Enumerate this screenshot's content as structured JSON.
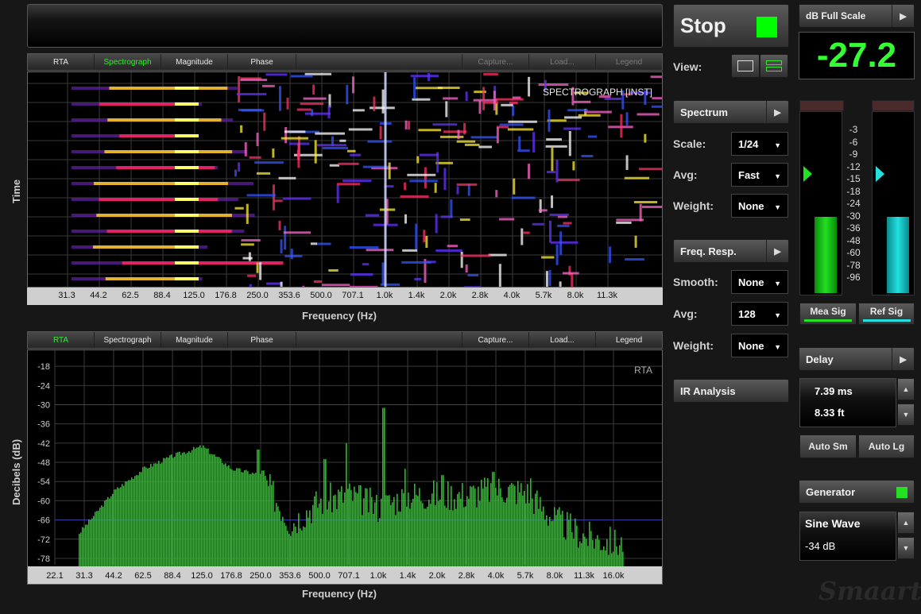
{
  "spectro_tabs": {
    "rta": "RTA",
    "spectrograph": "Spectrograph",
    "magnitude": "Magnitude",
    "phase": "Phase",
    "capture": "Capture...",
    "load": "Load...",
    "legend": "Legend"
  },
  "rta_tabs": {
    "rta": "RTA",
    "spectrograph": "Spectrograph",
    "magnitude": "Magnitude",
    "phase": "Phase",
    "capture": "Capture...",
    "load": "Load...",
    "legend": "Legend"
  },
  "spectrograph": {
    "overlay": "SPECTROGRAPH [INST]",
    "ylabel": "Time",
    "xlabel": "Frequency (Hz)",
    "ticks": [
      "31.3",
      "44.2",
      "62.5",
      "88.4",
      "125.0",
      "176.8",
      "250.0",
      "353.6",
      "500.0",
      "707.1",
      "1.0k",
      "1.4k",
      "2.0k",
      "2.8k",
      "4.0k",
      "5.7k",
      "8.0k",
      "11.3k"
    ]
  },
  "chart_data": {
    "type": "bar",
    "title": "RTA",
    "xlabel": "Frequency (Hz)",
    "ylabel": "Decibels (dB)",
    "ylim": [
      -80,
      -13
    ],
    "yticks": [
      -18,
      -24,
      -30,
      -36,
      -42,
      -48,
      -54,
      -60,
      -66,
      -72,
      -78
    ],
    "xticks": [
      "22.1",
      "31.3",
      "44.2",
      "62.5",
      "88.4",
      "125.0",
      "176.8",
      "250.0",
      "353.6",
      "500.0",
      "707.1",
      "1.0k",
      "1.4k",
      "2.0k",
      "2.8k",
      "4.0k",
      "5.7k",
      "8.0k",
      "11.3k",
      "16.0k"
    ],
    "reference_lines": [
      {
        "value": -30,
        "color": "#a02020"
      },
      {
        "value": -66,
        "color": "#3a3aa8"
      }
    ],
    "bar_color": "#22c022",
    "envelope": [
      {
        "freq": "22.1",
        "db": -79
      },
      {
        "freq": "31.3",
        "db": -68
      },
      {
        "freq": "44.2",
        "db": -57
      },
      {
        "freq": "62.5",
        "db": -50
      },
      {
        "freq": "88.4",
        "db": -46
      },
      {
        "freq": "125.0",
        "db": -43
      },
      {
        "freq": "176.8",
        "db": -50
      },
      {
        "freq": "250.0",
        "db": -52
      },
      {
        "freq": "353.6",
        "db": -67
      },
      {
        "freq": "500.0",
        "db": -60
      },
      {
        "freq": "707.1",
        "db": -58
      },
      {
        "freq": "1.0k",
        "db": -62
      },
      {
        "freq": "1.4k",
        "db": -58
      },
      {
        "freq": "2.0k",
        "db": -58
      },
      {
        "freq": "2.8k",
        "db": -58
      },
      {
        "freq": "4.0k",
        "db": -56
      },
      {
        "freq": "5.7k",
        "db": -57
      },
      {
        "freq": "8.0k",
        "db": -66
      },
      {
        "freq": "11.3k",
        "db": -71
      },
      {
        "freq": "16.0k",
        "db": -73
      }
    ],
    "peaks": [
      {
        "freq": "250.0",
        "db": -44
      },
      {
        "freq": "500.0",
        "db": -47
      },
      {
        "freq": "707.1",
        "db": -42
      },
      {
        "freq": "1.0k",
        "db": -31
      },
      {
        "freq": "1.4k",
        "db": -50
      },
      {
        "freq": "2.0k",
        "db": -52
      },
      {
        "freq": "4.0k",
        "db": -51
      },
      {
        "freq": "5.7k",
        "db": -53
      }
    ]
  },
  "rta_overlay": "RTA",
  "controls": {
    "stop": "Stop",
    "view_label": "View:",
    "spectrum": "Spectrum",
    "scale_label": "Scale:",
    "scale_value": "1/24",
    "avg_label": "Avg:",
    "avg_value": "Fast",
    "weight_label": "Weight:",
    "weight_value": "None",
    "freq_resp": "Freq. Resp.",
    "smooth_label": "Smooth:",
    "smooth_value": "None",
    "avg2_label": "Avg:",
    "avg2_value": "128",
    "weight2_label": "Weight:",
    "weight2_value": "None",
    "ir_analysis": "IR Analysis"
  },
  "right": {
    "db_full_scale": "dB Full Scale",
    "readout": "-27.2",
    "meter_scale": [
      "-3",
      "-6",
      "-9",
      "-12",
      "-15",
      "-18",
      "-24",
      "-30",
      "-36",
      "-48",
      "-60",
      "-78",
      "-96"
    ],
    "mea_level": 0.42,
    "ref_level": 0.42,
    "mea_sig": "Mea Sig",
    "ref_sig": "Ref Sig",
    "delay": "Delay",
    "delay_ms": "7.39 ms",
    "delay_ft": "8.33 ft",
    "auto_sm": "Auto Sm",
    "auto_lg": "Auto Lg",
    "generator": "Generator",
    "gen_type": "Sine Wave",
    "gen_level": "-34 dB",
    "logo": "Smaart"
  },
  "colors": {
    "green": "#22e022",
    "cyan": "#22e0e0",
    "accent_green": "#00ff00"
  }
}
